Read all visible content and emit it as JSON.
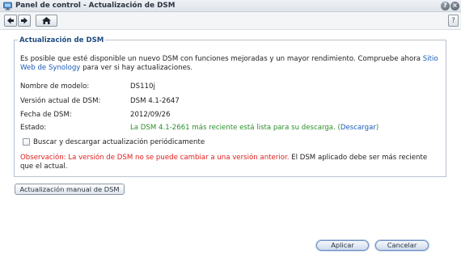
{
  "window": {
    "title": "Panel de control - Actualización de DSM",
    "help_glyph": "?",
    "close_glyph": "×"
  },
  "toolbar": {
    "help_glyph": "?"
  },
  "section": {
    "legend": "Actualización de DSM",
    "intro_text": "Es posible que esté disponible un nuevo DSM con funciones mejoradas y un mayor rendimiento. Compruebe ahora ",
    "intro_link": "Sitio Web de Synology",
    "intro_suffix": " para ver si hay actualizaciones.",
    "rows": [
      {
        "label": "Nombre de modelo:",
        "value": "DS110j"
      },
      {
        "label": "Versión actual de DSM:",
        "value": "DSM 4.1-2647"
      },
      {
        "label": "Fecha de DSM:",
        "value": "2012/09/26"
      }
    ],
    "status": {
      "label": "Estado:",
      "text": "La DSM 4.1-2661 más reciente está lista para su descarga.",
      "paren_open": " (",
      "link": "Descargar",
      "paren_close": ")"
    },
    "checkbox_label": "Buscar y descargar actualización periódicamente",
    "checkbox_checked": false,
    "note_red": "Observación: La versión de DSM no se puede cambiar a una versión anterior.",
    "note_rest": " El DSM aplicado debe ser más reciente que el actual."
  },
  "buttons": {
    "manual_update": "Actualización manual de DSM",
    "apply": "Aplicar",
    "cancel": "Cancelar"
  },
  "colors": {
    "link": "#1d5bb8",
    "success": "#2b8f2b",
    "warning": "#e02020",
    "legend": "#1f4d80"
  }
}
